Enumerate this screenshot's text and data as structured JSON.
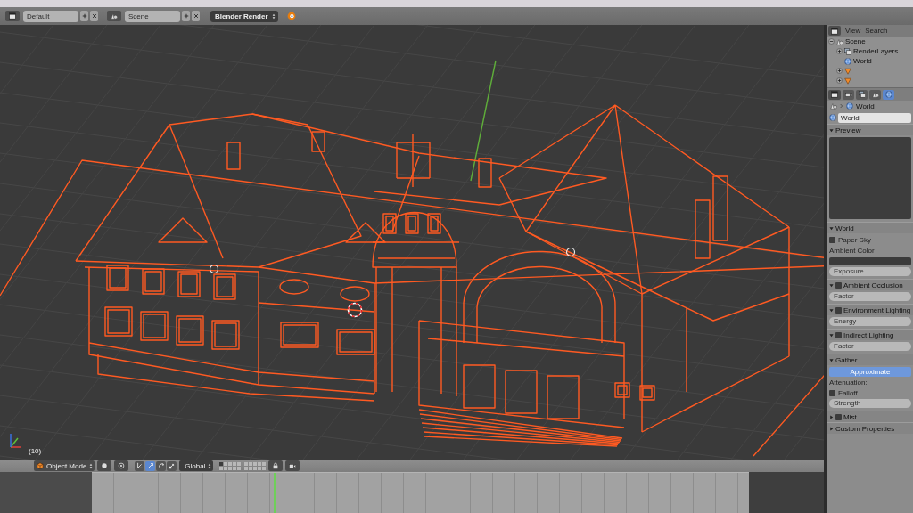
{
  "info_header": {
    "layout_field": "Default",
    "scene_field": "Scene",
    "render_engine": "Blender Render"
  },
  "viewport": {
    "frame_label": "(10)"
  },
  "viewport_header": {
    "mode": "Object Mode",
    "orientation": "Global",
    "transform_tools": [
      {
        "kind": "manipulator",
        "selected": false
      },
      {
        "kind": "translate",
        "selected": true
      },
      {
        "kind": "rotate",
        "selected": false
      },
      {
        "kind": "scale",
        "selected": false
      }
    ],
    "layers": [
      {
        "selected": true
      },
      {
        "selected": false
      },
      {
        "selected": false
      },
      {
        "selected": false
      },
      {
        "selected": false
      },
      {
        "selected": false
      },
      {
        "selected": false
      },
      {
        "selected": false
      },
      {
        "selected": false
      },
      {
        "selected": false
      },
      {
        "selected": false
      },
      {
        "selected": false
      },
      {
        "selected": false
      },
      {
        "selected": false
      },
      {
        "selected": false
      },
      {
        "selected": false
      },
      {
        "selected": false
      },
      {
        "selected": false
      },
      {
        "selected": false
      },
      {
        "selected": false
      }
    ]
  },
  "outliner": {
    "menu": [
      "View",
      "Search"
    ],
    "tree": [
      {
        "kind": "scene",
        "label": "Scene",
        "expanded": true,
        "children": [
          {
            "kind": "render_layers",
            "label": "RenderLayers",
            "expanded": false
          },
          {
            "kind": "world",
            "label": "World"
          },
          {
            "kind": "object",
            "expanded": false
          },
          {
            "kind": "object",
            "expanded": false
          }
        ]
      }
    ]
  },
  "properties": {
    "tabs": [
      {
        "kind": "render",
        "selected": false
      },
      {
        "kind": "layers",
        "selected": false
      },
      {
        "kind": "scene",
        "selected": false
      },
      {
        "kind": "world",
        "selected": true
      }
    ],
    "breadcrumb": [
      {
        "kind": "scene"
      },
      {
        "kind": "world",
        "label": "World"
      }
    ],
    "datablock": "World",
    "preview_panel": {
      "title": "Preview",
      "expanded": true
    },
    "panels": [
      {
        "title": "World",
        "expanded": true,
        "rows": [
          {
            "kind": "checkbox",
            "label": "Paper Sky",
            "checked": false
          },
          {
            "kind": "label",
            "label": "Ambient Color"
          },
          {
            "kind": "swatch"
          },
          {
            "kind": "field",
            "label": "Exposure"
          }
        ]
      },
      {
        "title": "Ambient Occlusion",
        "expanded": true,
        "checkbox": false,
        "rows": [
          {
            "kind": "field",
            "label": "Factor"
          }
        ]
      },
      {
        "title": "Environment Lighting",
        "expanded": true,
        "checkbox": false,
        "rows": [
          {
            "kind": "field",
            "label": "Energy"
          }
        ]
      },
      {
        "title": "Indirect Lighting",
        "expanded": true,
        "checkbox": false,
        "rows": [
          {
            "kind": "field",
            "label": "Factor"
          }
        ]
      },
      {
        "title": "Gather",
        "expanded": true,
        "rows": [
          {
            "kind": "toggle",
            "label": "Approximate",
            "selected": true
          },
          {
            "kind": "label",
            "label": "Attenuation:"
          },
          {
            "kind": "checkbox",
            "label": "Falloff",
            "checked": false
          },
          {
            "kind": "field",
            "label": "Strength"
          }
        ]
      },
      {
        "title": "Mist",
        "expanded": false,
        "checkbox": false
      },
      {
        "title": "Custom Properties",
        "expanded": false
      }
    ]
  }
}
